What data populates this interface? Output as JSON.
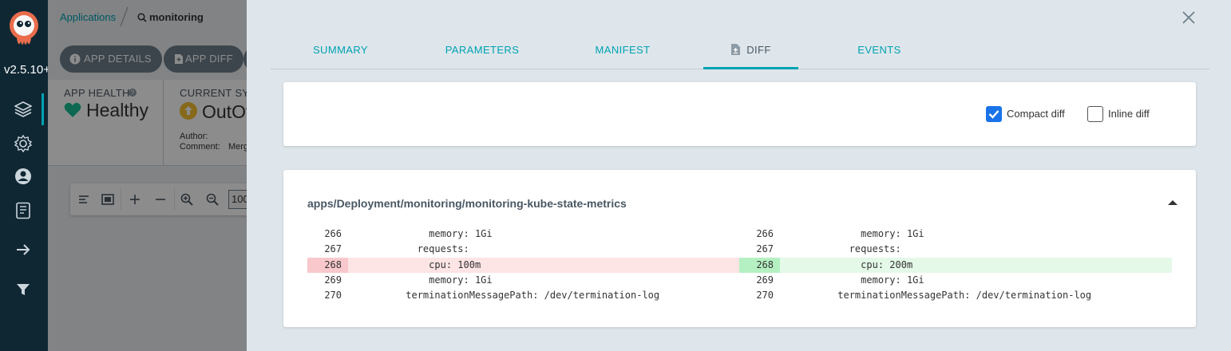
{
  "rail": {
    "version": "v2.5.10+",
    "icons": [
      "argo-logo",
      "applications-stack-icon",
      "settings-gear-icon",
      "user-icon",
      "docs-icon",
      "logout-arrow-icon",
      "filter-icon"
    ]
  },
  "background_app": {
    "breadcrumb": {
      "root": "Applications",
      "current": "monitoring"
    },
    "toolbar": {
      "app_details": "APP DETAILS",
      "app_diff": "APP DIFF"
    },
    "status": {
      "app_health_title": "APP HEALTH",
      "app_health_value": "Healthy",
      "current_sync_title": "CURRENT SYN",
      "current_sync_value": "OutOf",
      "author_label": "Author:",
      "comment_label": "Comment:",
      "comment_value": "Merg"
    },
    "zoom_value": "100"
  },
  "panel": {
    "tabs": [
      {
        "label": "SUMMARY",
        "active": false
      },
      {
        "label": "PARAMETERS",
        "active": false
      },
      {
        "label": "MANIFEST",
        "active": false
      },
      {
        "label": "DIFF",
        "active": true
      },
      {
        "label": "EVENTS",
        "active": false
      }
    ],
    "options": {
      "compact_diff": {
        "label": "Compact diff",
        "checked": true
      },
      "inline_diff": {
        "label": "Inline diff",
        "checked": false
      }
    },
    "diff": {
      "resource": "apps/Deployment/monitoring/monitoring-kube-state-metrics",
      "rows": [
        {
          "left_num": "266",
          "left_code": "              memory: 1Gi",
          "right_num": "266",
          "right_code": "              memory: 1Gi",
          "type": "same"
        },
        {
          "left_num": "267",
          "left_code": "            requests:",
          "right_num": "267",
          "right_code": "            requests:",
          "type": "same"
        },
        {
          "left_num": "268",
          "left_code": "              cpu: 100m",
          "right_num": "268",
          "right_code": "              cpu: 200m",
          "type": "changed"
        },
        {
          "left_num": "269",
          "left_code": "              memory: 1Gi",
          "right_num": "269",
          "right_code": "              memory: 1Gi",
          "type": "same"
        },
        {
          "left_num": "270",
          "left_code": "          terminationMessagePath: /dev/termination-log",
          "right_num": "270",
          "right_code": "          terminationMessagePath: /dev/termination-log",
          "type": "same"
        }
      ]
    }
  },
  "colors": {
    "accent": "#00a2b3",
    "rail_bg": "#0f2733",
    "healthy": "#18be94",
    "out_of_sync": "#f4c030",
    "removed_bg": "#fde4e5",
    "added_bg": "#e4f9e8"
  }
}
